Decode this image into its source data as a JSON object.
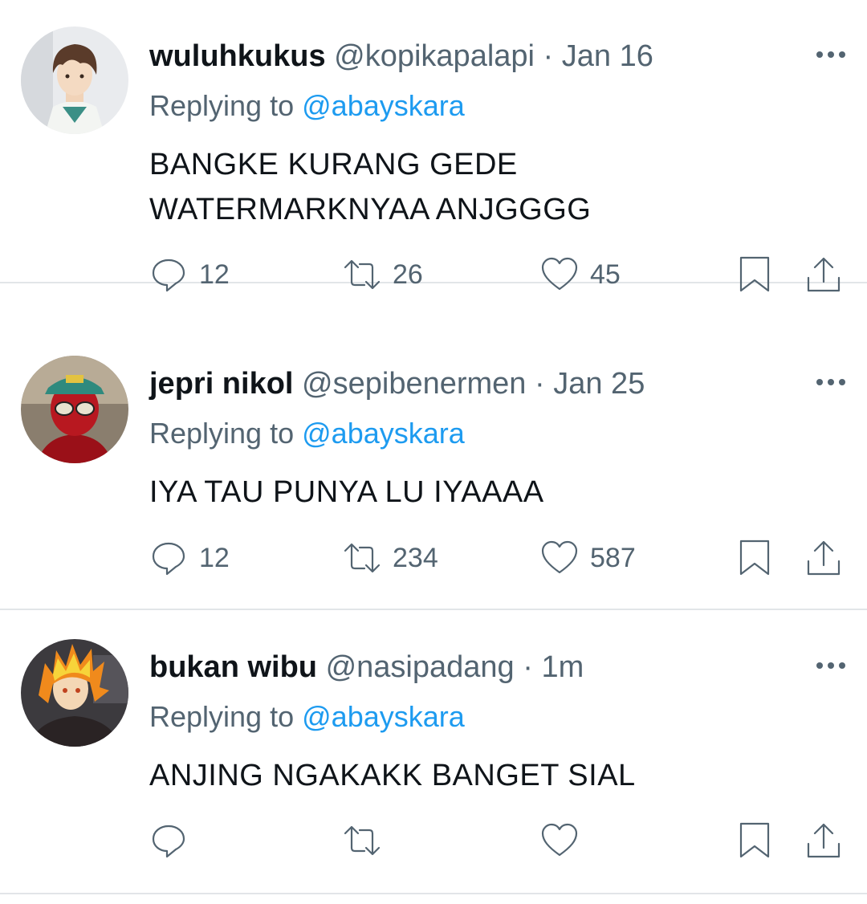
{
  "tweets": [
    {
      "display_name": "wuluhkukus",
      "handle": "@kopikapalapi",
      "separator": "·",
      "time": "Jan 16",
      "replying_label": "Replying to",
      "replying_to": "@abayskara",
      "text_line1": "BANGKE KURANG GEDE",
      "text_line2": "WATERMARKNYAA ANJGGGG",
      "replies": "12",
      "retweets": "26",
      "likes": "45"
    },
    {
      "display_name": "jepri nikol",
      "handle": "@sepibenermen",
      "separator": "·",
      "time": "Jan 25",
      "replying_label": "Replying to",
      "replying_to": "@abayskara",
      "text_line1": "IYA TAU PUNYA LU IYAAAA",
      "replies": "12",
      "retweets": "234",
      "likes": "587"
    },
    {
      "display_name": "bukan wibu",
      "handle": "@nasipadang",
      "separator": "·",
      "time": "1m",
      "replying_label": "Replying to",
      "replying_to": "@abayskara",
      "text_line1": "ANJING NGAKAKK BANGET SIAL"
    }
  ],
  "icons": {
    "reply": "reply-icon",
    "retweet": "retweet-icon",
    "like": "heart-icon",
    "bookmark": "bookmark-icon",
    "share": "share-icon",
    "more": "more-options-icon"
  },
  "colors": {
    "text": "#0f1419",
    "secondary": "#536471",
    "mention": "#1d9bf0",
    "divider": "#e2e5e8"
  }
}
